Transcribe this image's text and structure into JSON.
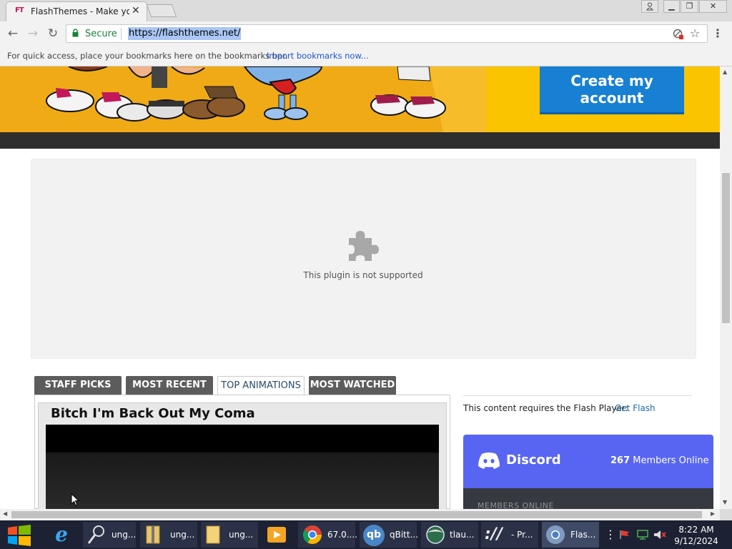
{
  "browser": {
    "tab_title": "FlashThemes - Make you",
    "tab_favicon_text": "FT",
    "secure_label": "Secure",
    "url": "https://flashthemes.net/",
    "bookmarks_hint": "For quick access, place your bookmarks here on the bookmarks bar.",
    "import_bookmarks": "Import bookmarks now..."
  },
  "page": {
    "create_account_button": "Create my account",
    "plugin_message": "This plugin is not supported",
    "tabs": [
      "STAFF PICKS",
      "MOST RECENT",
      "TOP ANIMATIONS",
      "MOST WATCHED"
    ],
    "active_tab": "TOP ANIMATIONS",
    "video_title": "Bitch I'm Back Out My Coma",
    "flash_message": "This content requires the Flash Player:",
    "get_flash_link": "Get Flash",
    "discord": {
      "name": "Discord",
      "members_count": "267",
      "members_online_label": "Members Online",
      "section_header": "MEMBERS ONLINE"
    }
  },
  "taskbar": {
    "items": [
      "ung...",
      "ung...",
      "ung...",
      "67.0....",
      "qBitt...",
      "tlau...",
      "- Pr...",
      "Flas..."
    ],
    "time": "8:22 AM",
    "date": "9/12/2024"
  },
  "colors": {
    "banner": "#f0aa15",
    "create_button": "#1780d3",
    "discord": "#5865f2",
    "tab_inactive": "#5c5c5c",
    "taskbar": "#1c2233"
  }
}
